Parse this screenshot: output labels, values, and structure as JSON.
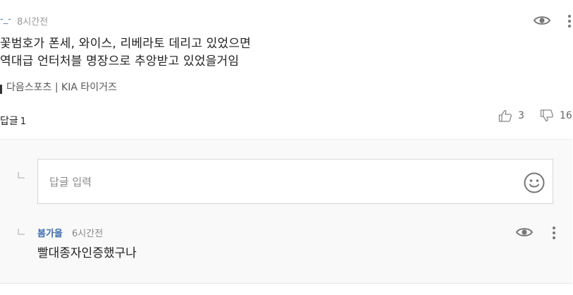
{
  "comment": {
    "author": "-_-",
    "time": "8시간전",
    "lines": [
      "꽃범호가 폰세, 와이스, 리베라토 데리고 있었으면",
      "역대급 언터처블 명장으로 추앙받고 있었을거임"
    ],
    "source": "다음스포츠 | KIA 타이거즈",
    "reply_label": "답글",
    "reply_count": "1",
    "likes": "3",
    "dislikes": "16"
  },
  "reply_input": {
    "placeholder": "답글 입력"
  },
  "replies": [
    {
      "author": "봄가을",
      "time": "6시간전",
      "text": "빨대종자인증했구나"
    }
  ],
  "icons": {
    "view": "eye-icon",
    "more": "more-vertical-icon",
    "like": "thumbs-up-icon",
    "dislike": "thumbs-down-icon",
    "emoji": "smiley-icon",
    "reply_arrow": "reply-arrow-icon"
  },
  "colors": {
    "author_link": "#5a7fb0",
    "reply_author": "#3c6bb0",
    "muted": "#999999",
    "reply_bg": "#f9f9f9"
  }
}
